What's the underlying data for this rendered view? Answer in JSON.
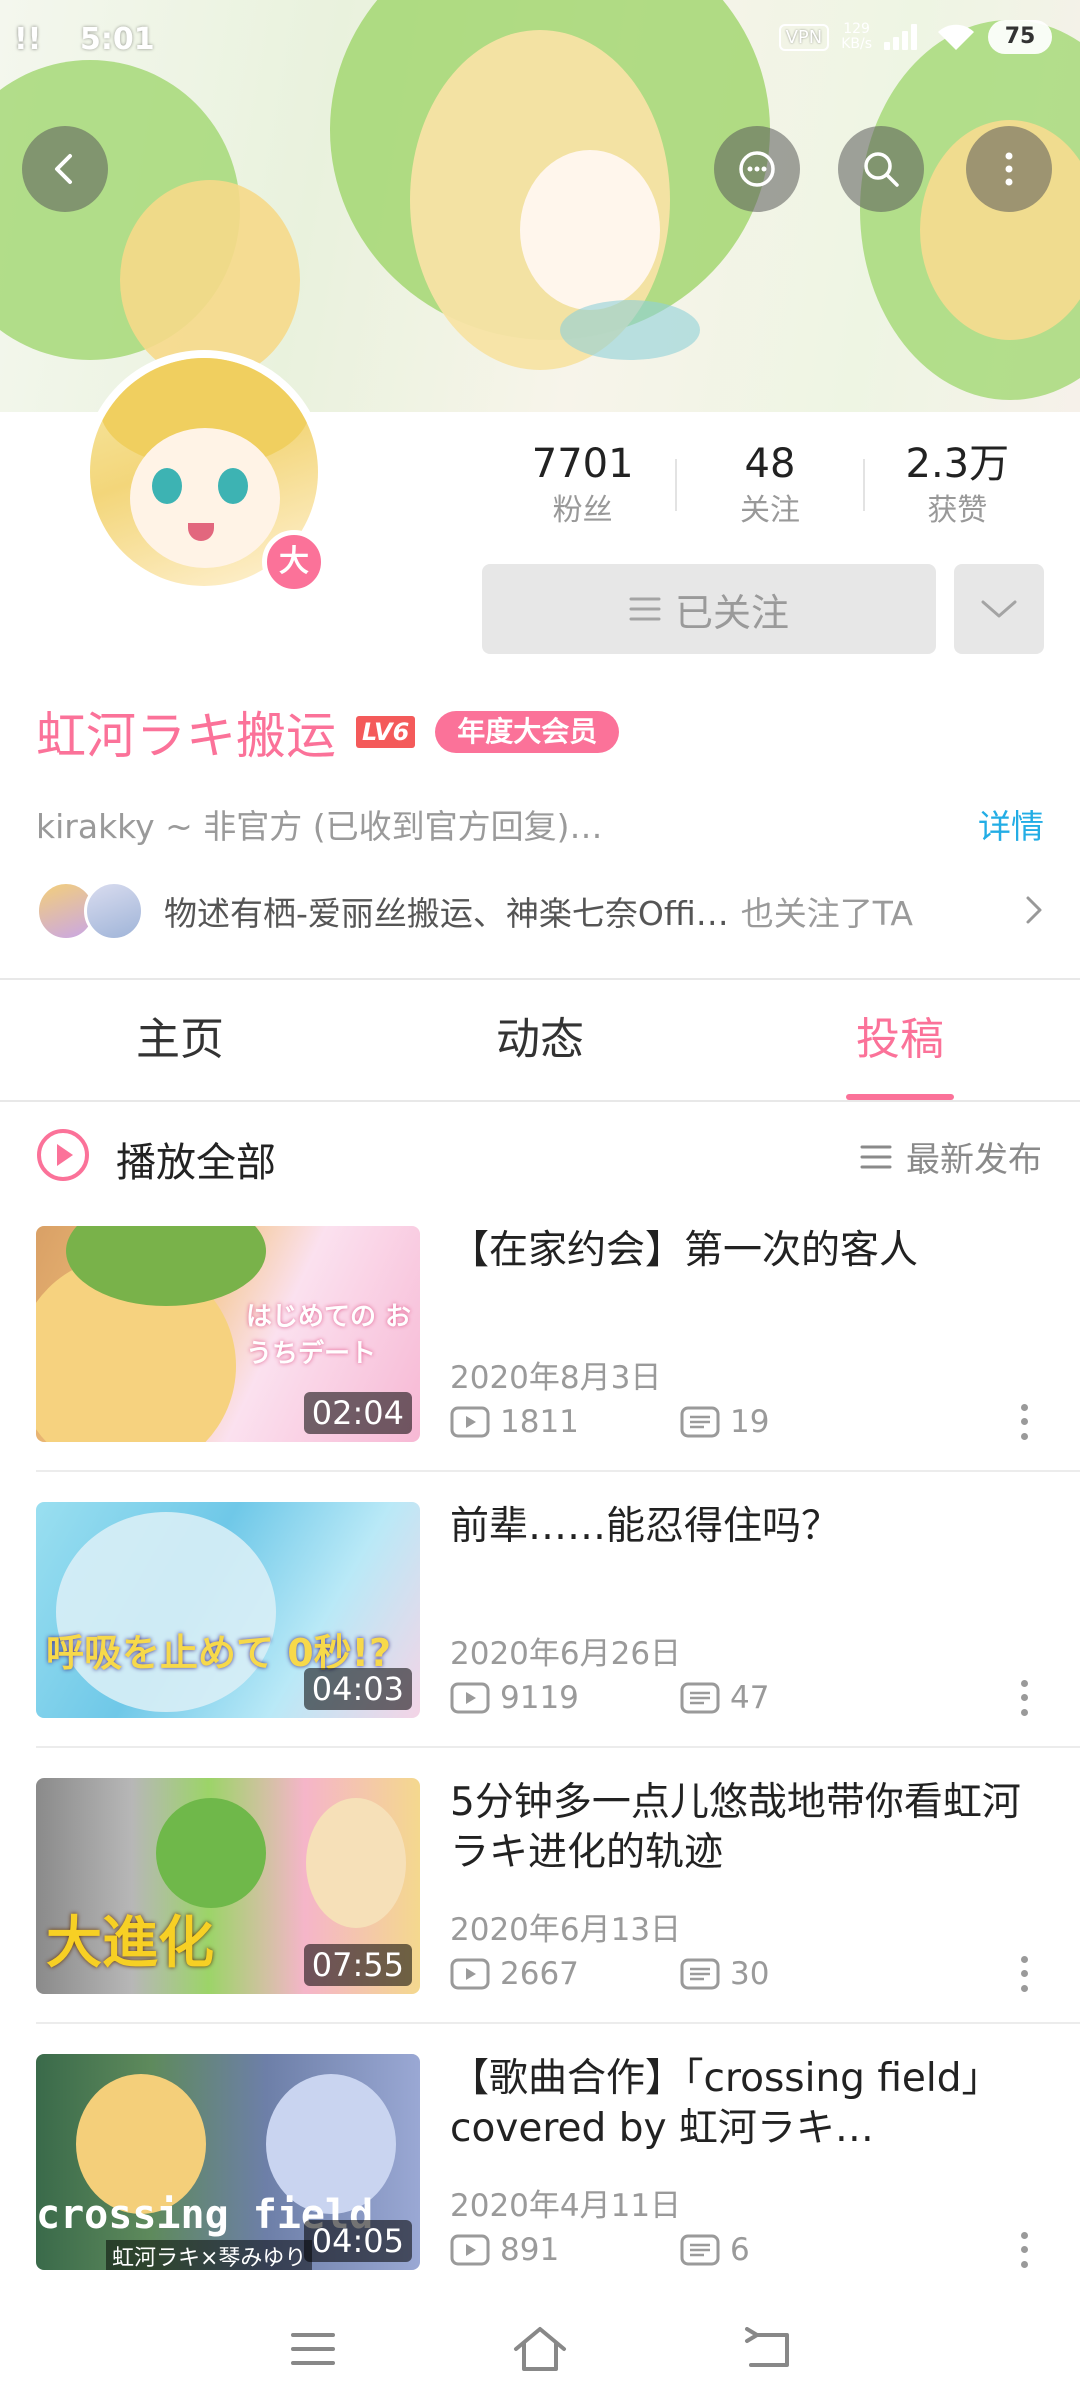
{
  "status_bar": {
    "notifications": "!!",
    "time": "5:01",
    "vpn": "VPN",
    "net_speed_value": "129",
    "net_speed_unit": "KB/s",
    "battery": "75"
  },
  "banner": {
    "back_icon": "back-arrow-icon",
    "chat_icon": "chat-bubble-icon",
    "search_icon": "search-icon",
    "more_icon": "more-vertical-icon"
  },
  "profile": {
    "avatar_badge": "大",
    "stats": [
      {
        "value": "7701",
        "label": "粉丝"
      },
      {
        "value": "48",
        "label": "关注"
      },
      {
        "value": "2.3万",
        "label": "获赞"
      }
    ],
    "follow_button": "已关注",
    "name": "虹河ラキ搬运",
    "level": "LV6",
    "vip_label": "年度大会员",
    "signature": "kirakky ~ 非官方 (已收到官方回复)…",
    "detail_link": "详情",
    "mutual_names": "物述有栖-爱丽丝搬运、神楽七奈Offi…",
    "mutual_tail": "也关注了TA"
  },
  "tabs": [
    {
      "label": "主页",
      "active": false
    },
    {
      "label": "动态",
      "active": false
    },
    {
      "label": "投稿",
      "active": true
    }
  ],
  "list_header": {
    "play_all": "播放全部",
    "sort": "最新发布"
  },
  "videos": [
    {
      "title": "【在家约会】第一次的客人",
      "date": "2020年8月3日",
      "views": "1811",
      "comments": "19",
      "duration": "02:04",
      "thumb_text": "はじめての おうちデート"
    },
    {
      "title": "前辈……能忍得住吗？",
      "date": "2020年6月26日",
      "views": "9119",
      "comments": "47",
      "duration": "04:03",
      "thumb_text": "呼吸を止めて 0秒!?"
    },
    {
      "title": "5分钟多一点儿悠哉地带你看虹河ラキ进化的轨迹",
      "date": "2020年6月13日",
      "views": "2667",
      "comments": "30",
      "duration": "07:55",
      "thumb_text": "大進化"
    },
    {
      "title": "【歌曲合作】「crossing field」 covered by 虹河ラキ…",
      "date": "2020年4月11日",
      "views": "891",
      "comments": "6",
      "duration": "04:05",
      "thumb_text": "crossing field",
      "thumb_subtext": "虹河ラキ×琴みゆり"
    }
  ],
  "colors": {
    "brand_pink": "#fb7299",
    "link_blue": "#23ade5",
    "muted_gray": "#9a9a9a"
  }
}
